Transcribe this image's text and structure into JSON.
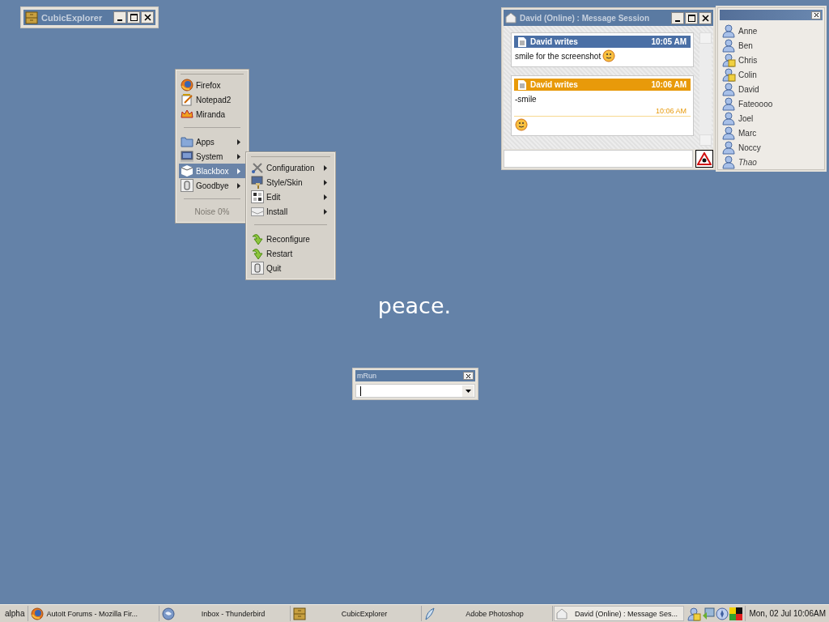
{
  "cubic_explorer": {
    "title": "CubicExplorer"
  },
  "root_menu": {
    "items": [
      {
        "kind": "launcher",
        "label": "Firefox",
        "selected": false
      },
      {
        "kind": "launcher",
        "label": "Notepad2",
        "selected": false
      },
      {
        "kind": "launcher",
        "label": "Miranda",
        "selected": false
      },
      {
        "kind": "separator"
      },
      {
        "kind": "submenu",
        "label": "Apps",
        "selected": false
      },
      {
        "kind": "submenu",
        "label": "System",
        "selected": false
      },
      {
        "kind": "submenu",
        "label": "Blackbox",
        "selected": true
      },
      {
        "kind": "submenu",
        "label": "Goodbye",
        "selected": false
      },
      {
        "kind": "separator"
      }
    ],
    "status": "Noise 0%"
  },
  "blackbox_menu": {
    "items": [
      {
        "kind": "submenu",
        "label": "Configuration",
        "selected": false
      },
      {
        "kind": "submenu",
        "label": "Style/Skin",
        "selected": false
      },
      {
        "kind": "submenu",
        "label": "Edit",
        "selected": false
      },
      {
        "kind": "submenu",
        "label": "Install",
        "selected": false
      },
      {
        "kind": "separator"
      },
      {
        "kind": "launcher",
        "label": "Reconfigure",
        "selected": false
      },
      {
        "kind": "launcher",
        "label": "Restart",
        "selected": false
      },
      {
        "kind": "launcher",
        "label": "Quit",
        "selected": false
      }
    ]
  },
  "desktop_text": "peace.",
  "message_session": {
    "title": "David (Online) : Message Session",
    "messages": [
      {
        "author": "David writes",
        "time": "10:05 AM",
        "color": "#4a6fa5",
        "lines": [
          {
            "kind": "text",
            "text": "smile for the screenshot",
            "emoticon": true
          }
        ]
      },
      {
        "author": "David writes",
        "time": "10:06 AM",
        "color": "#e89a0a",
        "lines": [
          {
            "kind": "text",
            "text": "-smile",
            "emoticon": false
          },
          {
            "kind": "stamp",
            "text": "10:06 AM"
          },
          {
            "kind": "emoticon"
          }
        ]
      }
    ]
  },
  "contacts": [
    {
      "name": "Anne",
      "kind": "online"
    },
    {
      "name": "Ben",
      "kind": "online"
    },
    {
      "name": "Chris",
      "kind": "away"
    },
    {
      "name": "Colin",
      "kind": "away"
    },
    {
      "name": "David",
      "kind": "online"
    },
    {
      "name": "Fateoooo",
      "kind": "online"
    },
    {
      "name": "Joel",
      "kind": "online"
    },
    {
      "name": "Marc",
      "kind": "online"
    },
    {
      "name": "Noccy",
      "kind": "online"
    },
    {
      "name": "Thao",
      "kind": "idle"
    }
  ],
  "mrun": {
    "title": "mRun"
  },
  "taskbar": {
    "workspace": "alpha",
    "tasks": [
      {
        "label": "AutoIt Forums - Mozilla Fir...",
        "selected": false
      },
      {
        "label": "Inbox - Thunderbird",
        "selected": false
      },
      {
        "label": "CubicExplorer",
        "selected": false
      },
      {
        "label": "Adobe Photoshop",
        "selected": false
      },
      {
        "label": "David (Online) : Message Ses...",
        "selected": true
      }
    ],
    "clock": "Mon, 02 Jul 10:06AM"
  }
}
